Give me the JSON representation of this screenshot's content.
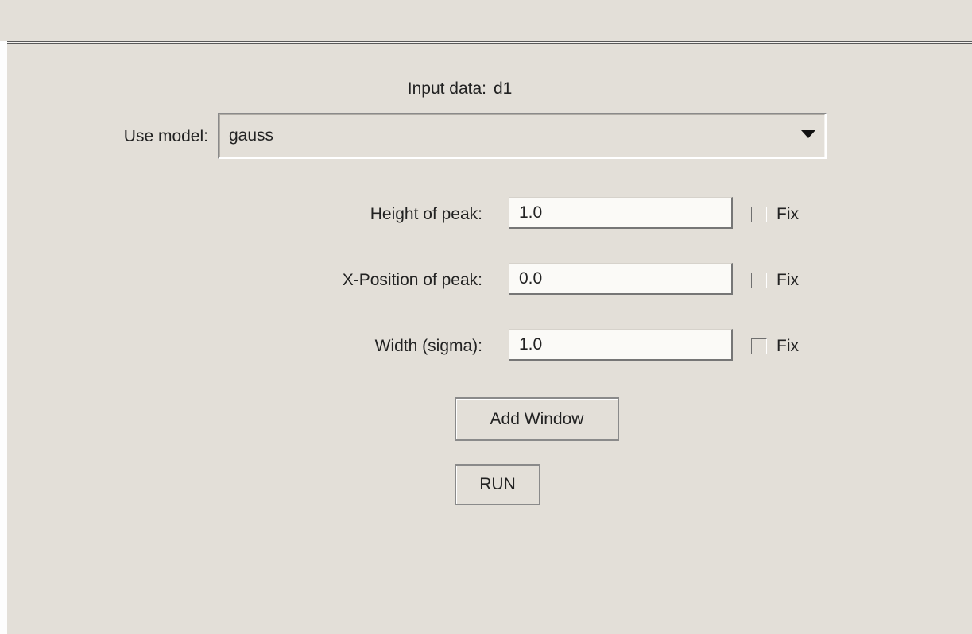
{
  "input": {
    "label": "Input data:",
    "value": "d1"
  },
  "model": {
    "label": "Use model:",
    "selected": "gauss"
  },
  "parameters": [
    {
      "label": "Height of peak:",
      "value": "1.0",
      "fix_label": "Fix",
      "fixed": false
    },
    {
      "label": "X-Position of peak:",
      "value": "0.0",
      "fix_label": "Fix",
      "fixed": false
    },
    {
      "label": "Width (sigma):",
      "value": "1.0",
      "fix_label": "Fix",
      "fixed": false
    }
  ],
  "buttons": {
    "add_window": "Add Window",
    "run": "RUN"
  },
  "colors": {
    "background": "#e3dfd8",
    "field_background": "#fbfaf7",
    "text": "#222222"
  }
}
